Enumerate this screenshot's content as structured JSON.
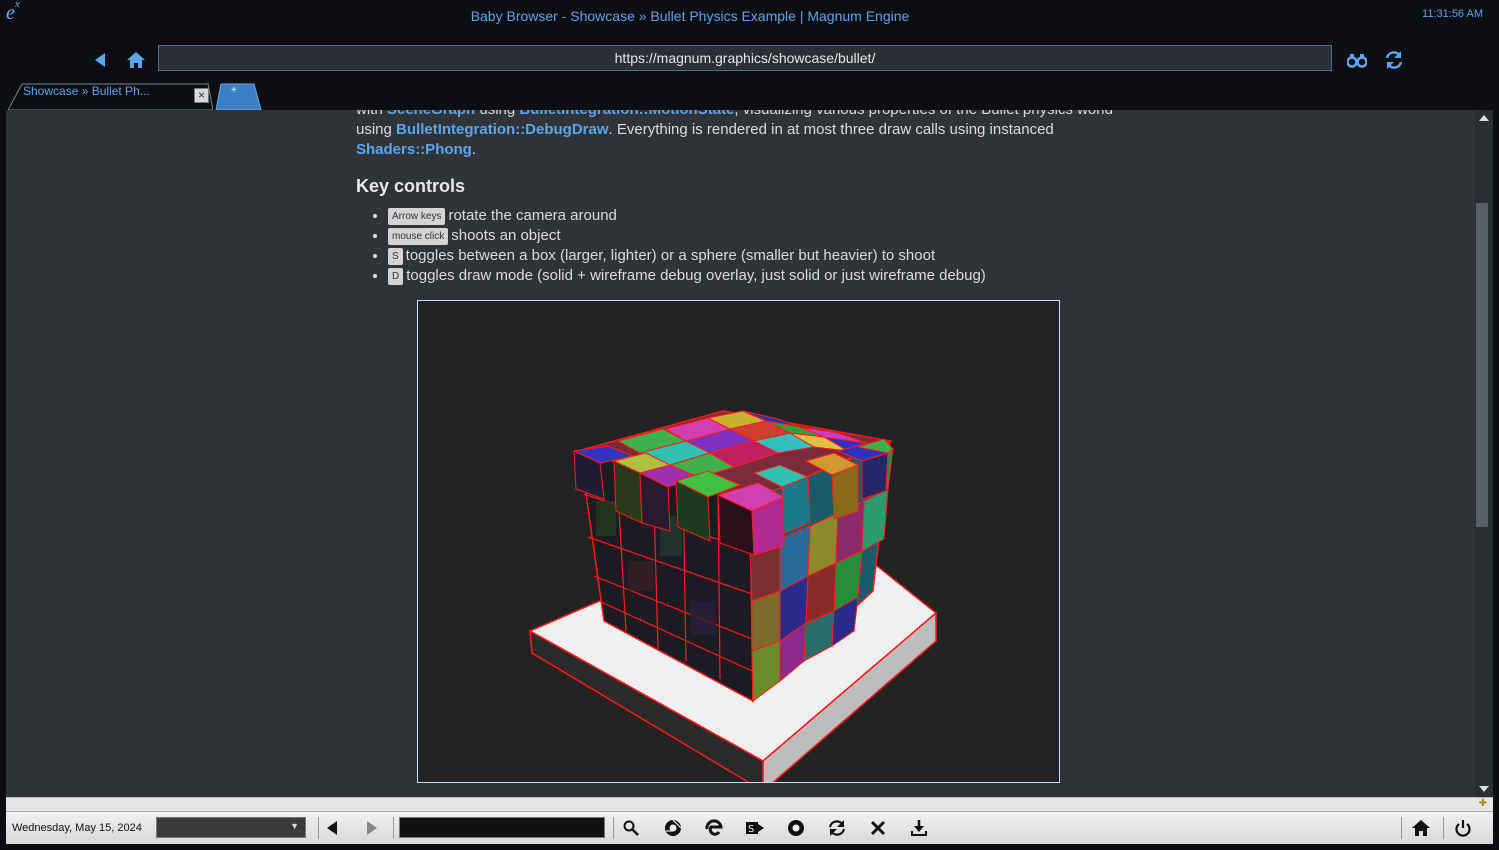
{
  "window": {
    "title": "Baby Browser - Showcase » Bullet Physics Example | Magnum Engine",
    "clock": "11:31:56 AM",
    "logo_base": "e",
    "logo_sup": "x"
  },
  "nav": {
    "url": "https://magnum.graphics/showcase/bullet/"
  },
  "tabs": [
    {
      "label": "Showcase » Bullet Ph...",
      "close": "×"
    }
  ],
  "newtab": {
    "label": "+"
  },
  "page": {
    "intro": {
      "l1_a": "with ",
      "l1_link1": "SceneGraph",
      "l1_b": " using ",
      "l1_link2": "BulletIntegration::MotionState",
      "l1_c": ", visualizing various properties of the Bullet physics world",
      "l2_a": "using ",
      "l2_link": "BulletIntegration::DebugDraw",
      "l2_b": ". Everything is rendered in at most three draw calls using instanced",
      "l3_link": "Shaders::Phong",
      "l3_b": "."
    },
    "heading": "Key controls",
    "controls": [
      {
        "key": "Arrow keys",
        "text": "rotate the camera around"
      },
      {
        "key": "mouse click",
        "text": "shoots an object"
      },
      {
        "key": "S",
        "text": "toggles between a box (larger, lighter) or a sphere (smaller but heavier) to shoot"
      },
      {
        "key": "D",
        "text": "toggles draw mode (solid + wireframe debug overlay, just solid or just wireframe debug)"
      }
    ]
  },
  "statusbar": {
    "date": "Wednesday, May 15, 2024",
    "icons": [
      "back-icon",
      "forward-icon",
      "search-icon",
      "chrome-icon",
      "edge-icon",
      "sync-icon",
      "firefox-icon",
      "refresh-icon",
      "tools-icon",
      "download-icon",
      "home-icon",
      "power-icon"
    ]
  },
  "colors": {
    "accent": "#5aa6ee",
    "page_bg": "#2f3237",
    "canvas_bg": "#222222",
    "wire": "#ff1a1a"
  }
}
